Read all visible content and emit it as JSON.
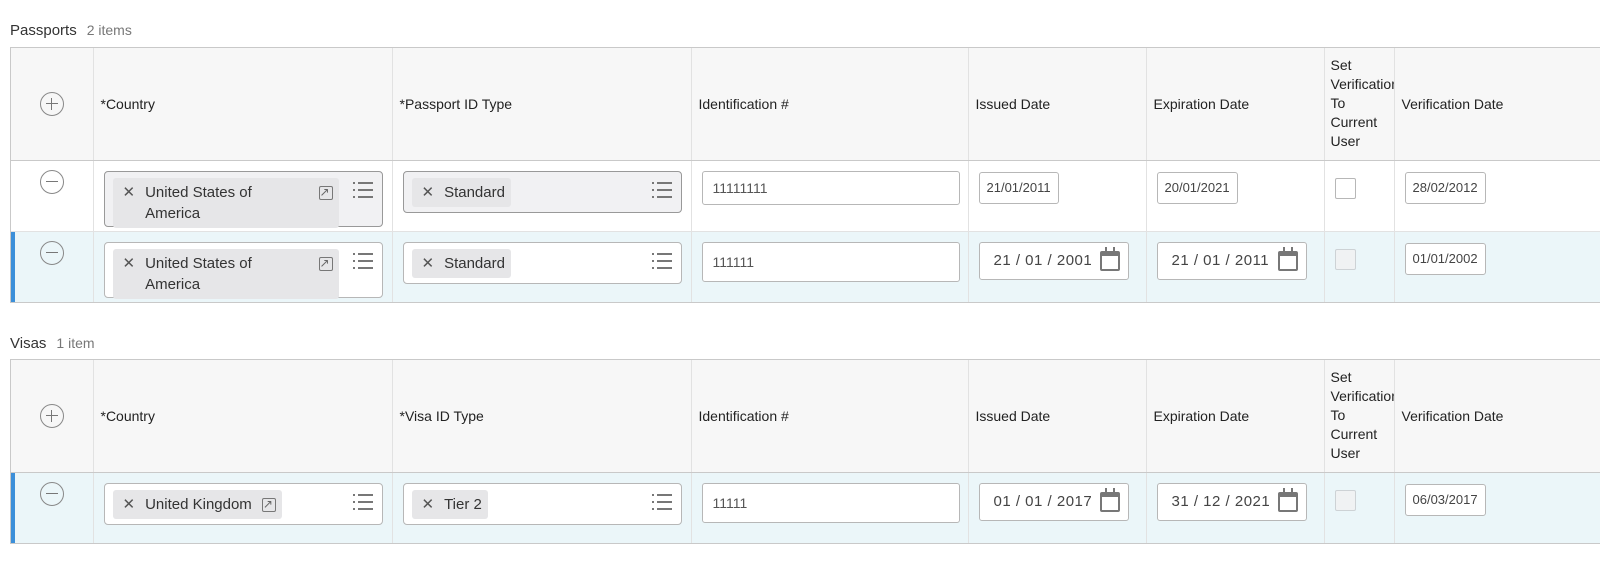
{
  "passports": {
    "title": "Passports",
    "count": "2 items",
    "columns": {
      "country": "*Country",
      "id_type": "*Passport ID Type",
      "id_number": "Identification #",
      "issued": "Issued Date",
      "expiration": "Expiration Date",
      "set_verification": "Set Verification To Current User",
      "verification": "Verification Date"
    },
    "rows": [
      {
        "country": "United States of America",
        "id_type": "Standard",
        "id_number": "11111111",
        "issued": "21/01/2011",
        "expiration": "20/01/2021",
        "verification": "28/02/2012"
      },
      {
        "country": "United States of America",
        "id_type": "Standard",
        "id_number": "111111",
        "issued": "21 / 01 / 2001",
        "expiration": "21 / 01 / 2011",
        "verification": "01/01/2002"
      }
    ]
  },
  "visas": {
    "title": "Visas",
    "count": "1 item",
    "columns": {
      "country": "*Country",
      "id_type": "*Visa ID Type",
      "id_number": "Identification #",
      "issued": "Issued Date",
      "expiration": "Expiration Date",
      "set_verification": "Set Verification To Current User",
      "verification": "Verification Date"
    },
    "rows": [
      {
        "country": "United Kingdom",
        "id_type": "Tier 2",
        "id_number": "11111",
        "issued": "01 / 01 / 2017",
        "expiration": "31 / 12 / 2021",
        "verification": "06/03/2017"
      }
    ]
  },
  "icons": {
    "add": "plus-circle-icon",
    "remove": "minus-circle-icon",
    "clear": "close-icon",
    "open": "external-link-icon",
    "prompt": "list-icon",
    "calendar": "calendar-icon"
  }
}
